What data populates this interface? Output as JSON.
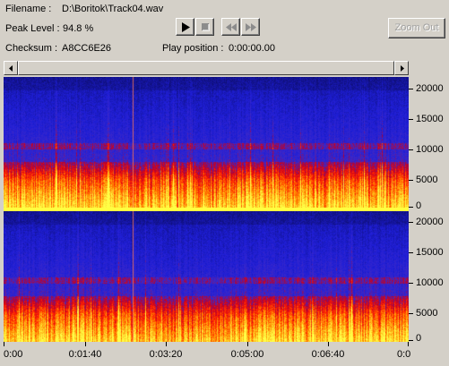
{
  "info": {
    "filename_label": "Filename :",
    "filename_value": "D:\\Boritok\\Track04.wav",
    "peak_label": "Peak Level :",
    "peak_value": "94.8 %",
    "checksum_label": "Checksum :",
    "checksum_value": "A8CC6E26",
    "play_position_label": "Play position :",
    "play_position_value": "0:00:00.00"
  },
  "transport": {
    "play_icon": "play-icon",
    "stop_icon": "stop-icon",
    "rewind_icon": "rewind-icon",
    "forward_icon": "fast-forward-icon"
  },
  "toolbar": {
    "zoom_out_label": "Zoom Out"
  },
  "spectrogram": {
    "y_ticks": [
      "20000",
      "15000",
      "10000",
      "5000",
      "0"
    ],
    "x_ticks": [
      "0:00",
      "0:01:40",
      "0:03:20",
      "0:05:00",
      "0:06:40",
      "0:0"
    ],
    "colors": {
      "background": "#1c1cc8",
      "high": "#ffff40",
      "mid": "#ff2000",
      "band": "#b00020",
      "separator": "#ffff40"
    }
  }
}
